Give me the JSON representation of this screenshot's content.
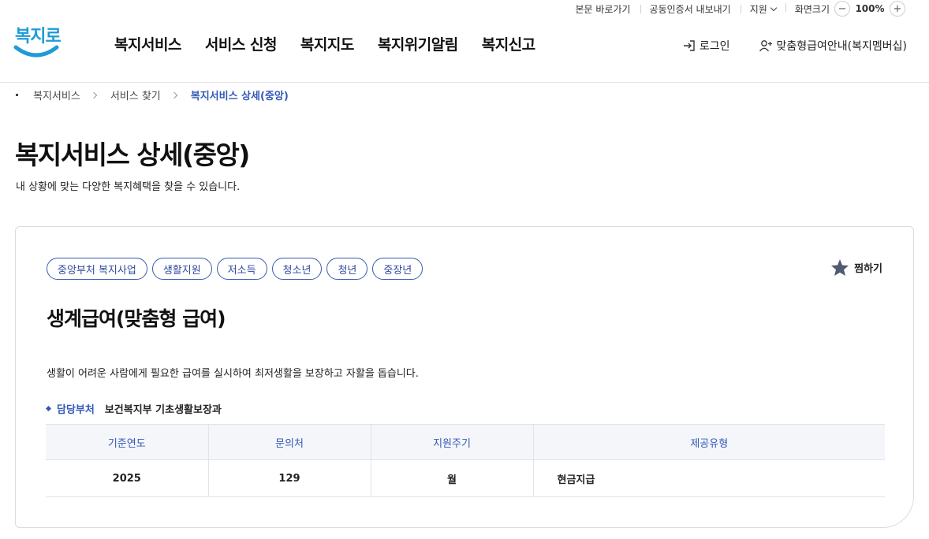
{
  "utility": {
    "skip_link": "본문 바로가기",
    "certificate": "공동인증서 내보내기",
    "support": "지원",
    "zoom_label": "화면크기",
    "zoom_minus": "−",
    "zoom_value": "100%",
    "zoom_plus": "+"
  },
  "logo": {
    "text": "복지로"
  },
  "nav": {
    "items": [
      {
        "label": "복지서비스"
      },
      {
        "label": "서비스 신청"
      },
      {
        "label": "복지지도"
      },
      {
        "label": "복지위기알림"
      },
      {
        "label": "복지신고"
      }
    ],
    "login": "로그인",
    "membership": "맞춤형급여안내(복지멤버십)"
  },
  "breadcrumb": {
    "items": [
      {
        "label": "복지서비스"
      },
      {
        "label": "서비스 찾기"
      },
      {
        "label": "복지서비스 상세(중앙)"
      }
    ]
  },
  "page": {
    "title": "복지서비스 상세(중앙)",
    "subtitle": "내 상황에 맞는 다양한 복지혜택을 찾을 수 있습니다."
  },
  "service": {
    "tags": [
      "중앙부처 복지사업",
      "생활지원",
      "저소득",
      "청소년",
      "청년",
      "중장년"
    ],
    "favorite_label": "찜하기",
    "title": "생계급여(맞춤형 급여)",
    "description": "생활이 어려운 사람에게 필요한 급여를 실시하여 최저생활을 보장하고 자활을 돕습니다.",
    "dept_label": "담당부처",
    "dept_value": "보건복지부 기초생활보장과",
    "table": {
      "headers": [
        "기준연도",
        "문의처",
        "지원주기",
        "제공유형"
      ],
      "row": [
        "2025",
        "129",
        "월",
        "현금지급"
      ]
    }
  },
  "colors": {
    "accent": "#3358b7",
    "logo": "#1f9bd7",
    "star": "#505a70"
  }
}
